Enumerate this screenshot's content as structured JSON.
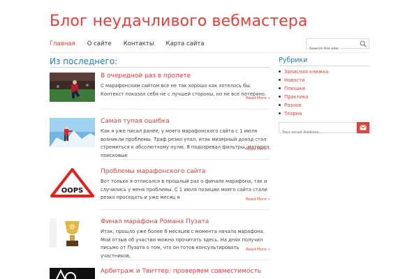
{
  "site": {
    "title": "Блог неудачливого вебмастера"
  },
  "nav": {
    "items": [
      {
        "label": "Главная",
        "active": true
      },
      {
        "label": "О сайте",
        "active": false
      },
      {
        "label": "Контакты",
        "active": false
      },
      {
        "label": "Карта сайта",
        "active": false
      }
    ]
  },
  "search": {
    "placeholder": "Search the site",
    "icon": "search-icon"
  },
  "main": {
    "section_title": "Из последнего:",
    "posts": [
      {
        "title": "В очередной раз в пролете",
        "excerpt": "С марафонским сайтом все не так хорошо как хотелось бы. Контекст показал себя не с лучшей стороны, но не все потеряно.",
        "more": "Read More »"
      },
      {
        "title": "Самая тупая ошибка",
        "excerpt": "Как я уже писал ранее, у моего марафонского сайта с 1 июля возникли проблемы. Траф резко упал, итак мизерный доход стал стремиться к абсолютному нулю. Я подозревал фильтры, материл поисковые",
        "more": "Read More »"
      },
      {
        "title": "Проблемы марафонского сайта",
        "excerpt": "Вот только я отписался в прошлый раз о финале марафона, так и случились у меня проблемы. С 1 июля позиции моего сайта стали резко проседать и уже месяц я",
        "more": "Read More »",
        "thumb_text": "OOPS"
      },
      {
        "title": "Финал марафона Романа Пузата",
        "excerpt": "Итак, прошло уже более 6 месяцев с момента начала марафона. Мой отзыв об участии можно прочитать здесь. На днях получил письмо от Пузата о том, что он готов консультировать участников,",
        "more": "Read More »"
      },
      {
        "title": "Арбитраж и Твиттер: проверяем совместимость",
        "excerpt": "",
        "more": ""
      }
    ]
  },
  "sidebar": {
    "title": "Рубрики",
    "categories": [
      "Записная книжка",
      "Новости",
      "Плюшки",
      "Практика",
      "Разное",
      "Теория"
    ],
    "email_placeholder": "Your email Address...",
    "email_icon": "envelope-icon"
  },
  "colors": {
    "accent": "#e2413b",
    "heading_blue": "#1f7bb6"
  }
}
